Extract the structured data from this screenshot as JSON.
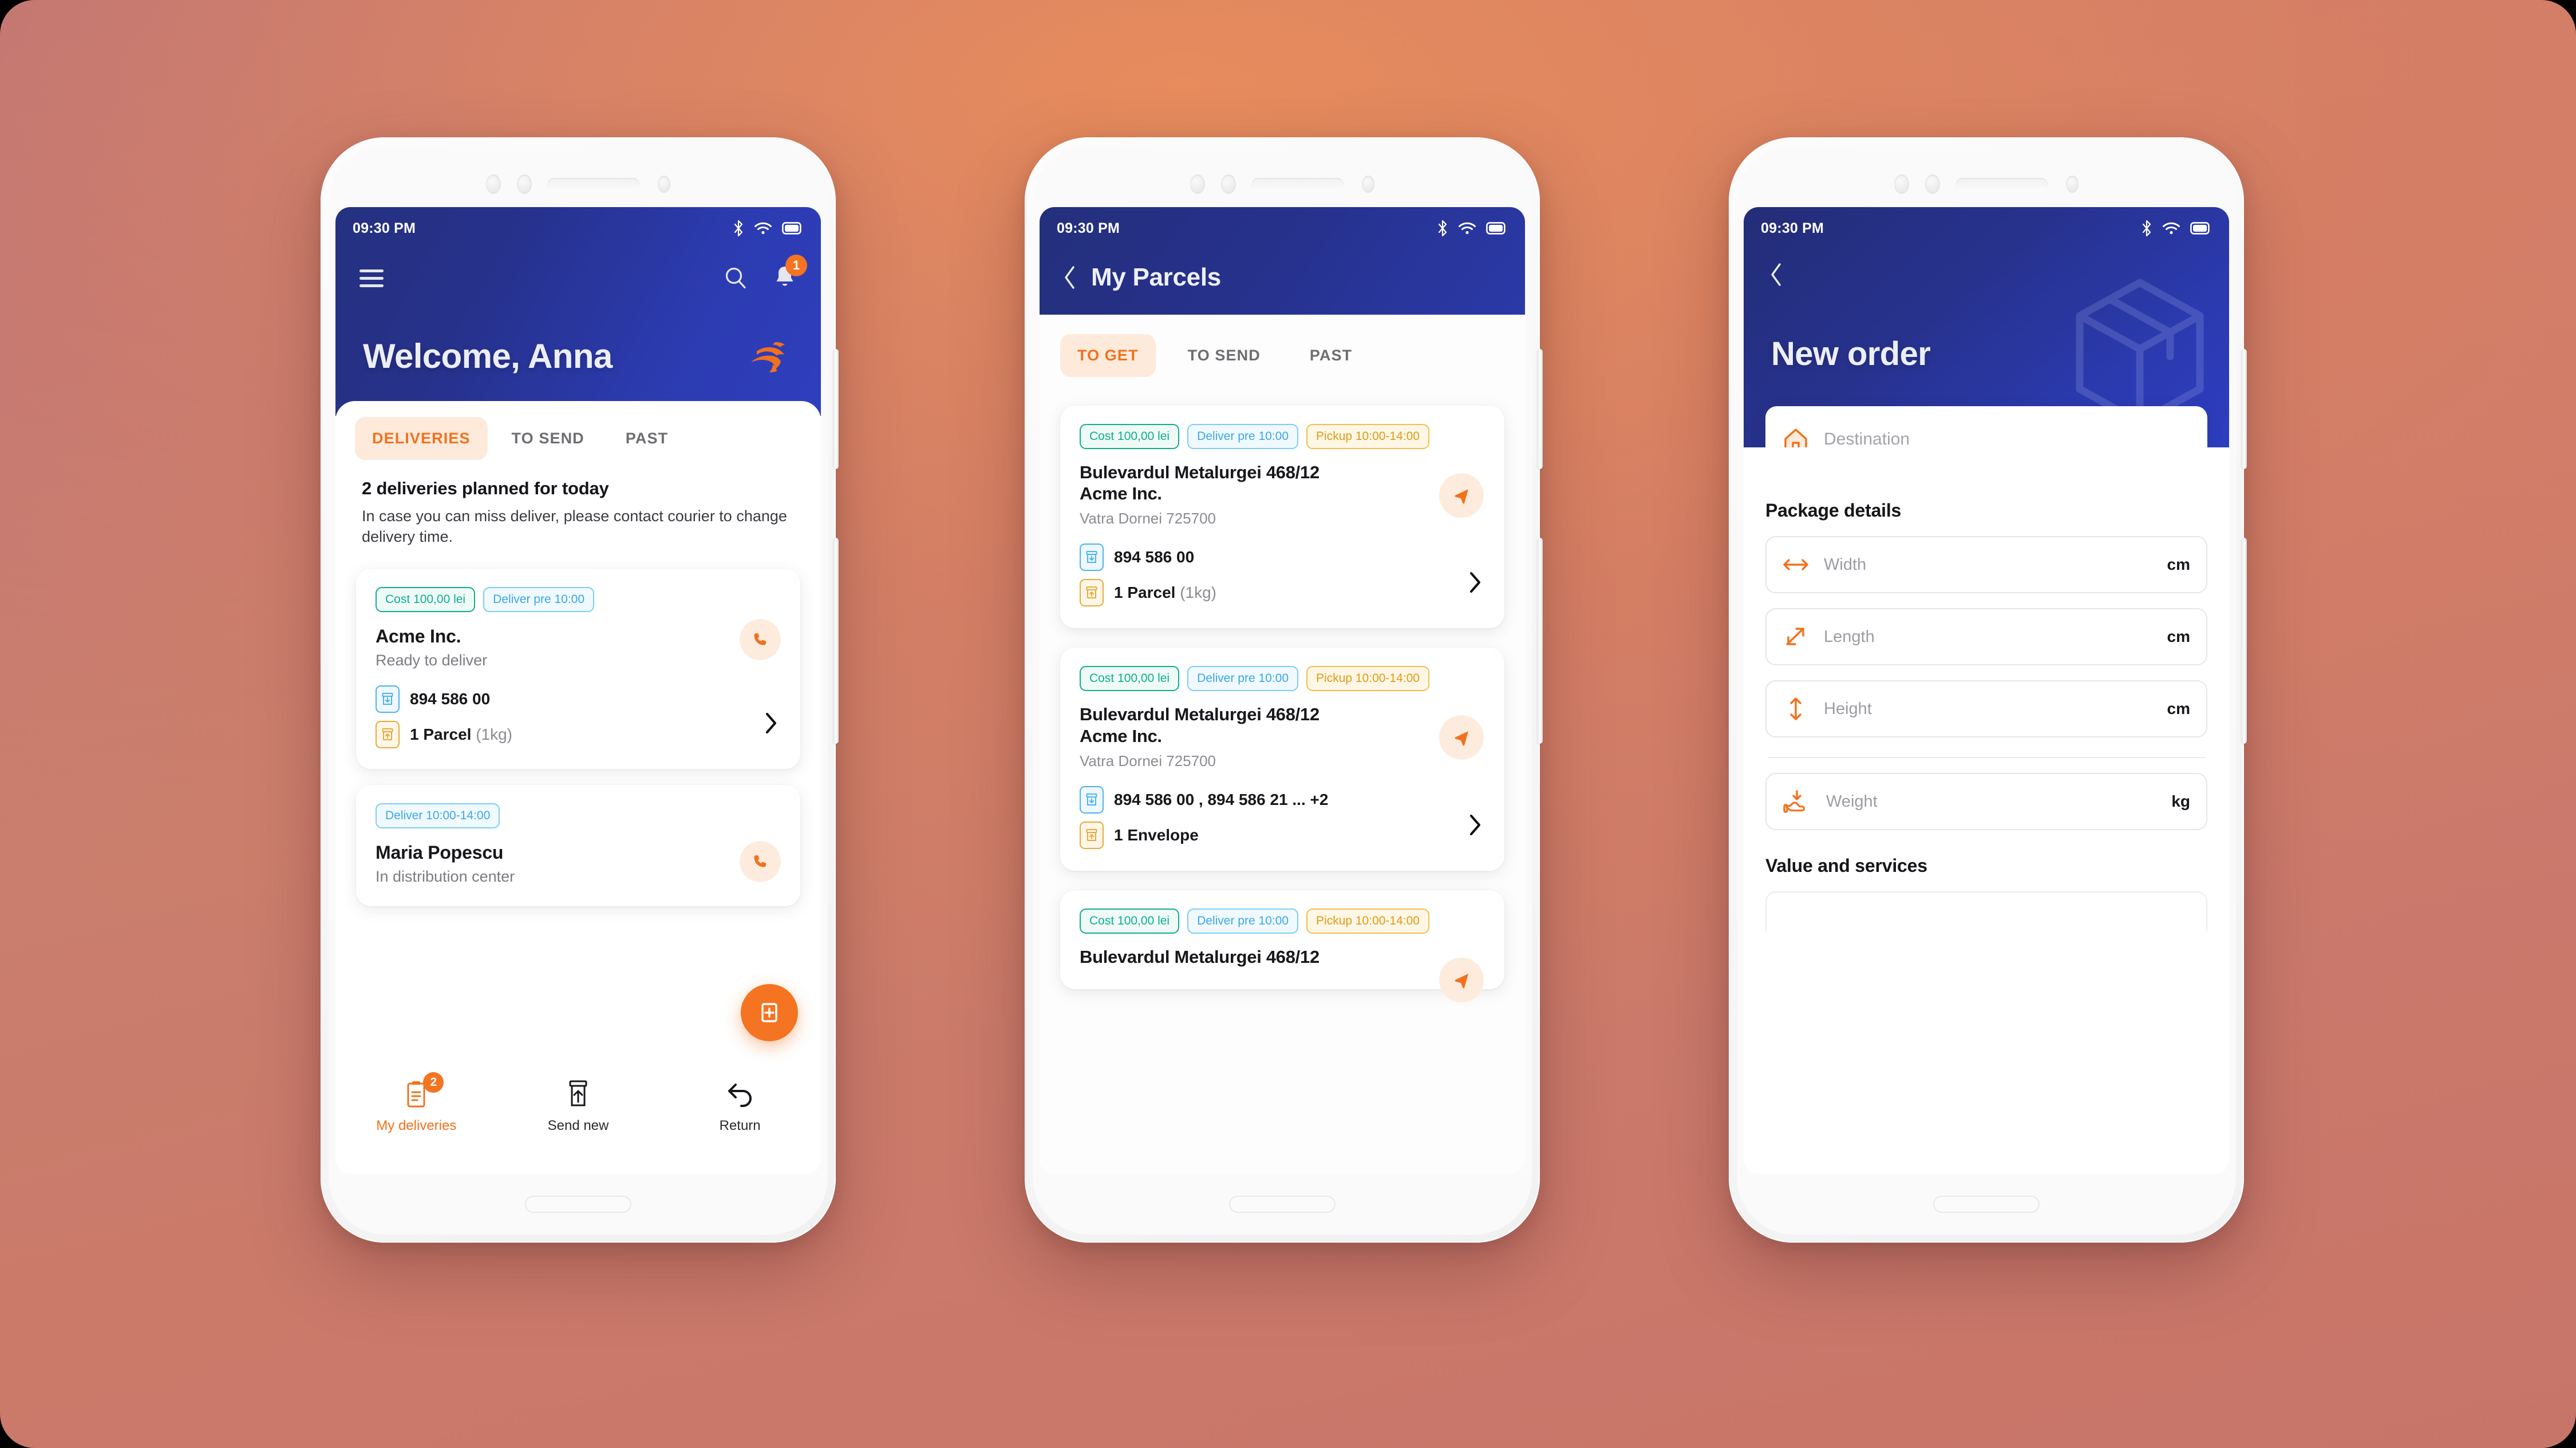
{
  "status_bar": {
    "time": "09:30 PM",
    "icons": [
      "bluetooth-icon",
      "wifi-icon",
      "battery-icon"
    ]
  },
  "phone1": {
    "header": {
      "menu_icon": "hamburger-menu-icon",
      "search_icon": "search-icon",
      "notification_icon": "bell-icon",
      "notification_count": "1",
      "welcome_title": "Welcome, Anna",
      "brand_logo": "running-courier-logo"
    },
    "tabs": [
      {
        "label": "DELIVERIES",
        "active": true
      },
      {
        "label": "TO SEND",
        "active": false
      },
      {
        "label": "PAST",
        "active": false
      }
    ],
    "summary": {
      "title": "2 deliveries planned for today",
      "subtitle": "In case you can miss deliver, please contact courier to change delivery time."
    },
    "cards": [
      {
        "chips": [
          {
            "text": "Cost 100,00 lei",
            "tone": "green"
          },
          {
            "text": "Deliver pre 10:00",
            "tone": "blue"
          }
        ],
        "title": "Acme Inc.",
        "subtitle": "Ready to deliver",
        "tracking": "894 586 00",
        "parcel": "1 Parcel",
        "parcel_weight": "(1kg)",
        "action_icon": "phone-icon"
      },
      {
        "chips": [
          {
            "text": "Deliver 10:00-14:00",
            "tone": "blue"
          }
        ],
        "title": "Maria Popescu",
        "subtitle": "In distribution center",
        "action_icon": "phone-icon"
      }
    ],
    "fab": {
      "icon": "add-parcel-icon"
    },
    "bottom_nav": [
      {
        "label": "My deliveries",
        "icon": "clipboard-icon",
        "badge": "2",
        "active": true
      },
      {
        "label": "Send new",
        "icon": "envelope-up-icon",
        "badge": "",
        "active": false
      },
      {
        "label": "Return",
        "icon": "return-arrow-icon",
        "badge": "",
        "active": false
      }
    ]
  },
  "phone2": {
    "header": {
      "back_icon": "chevron-left-icon",
      "title": "My Parcels"
    },
    "tabs": [
      {
        "label": "TO GET",
        "active": true
      },
      {
        "label": "TO SEND",
        "active": false
      },
      {
        "label": "PAST",
        "active": false
      }
    ],
    "cards": [
      {
        "chips": [
          {
            "text": "Cost 100,00 lei",
            "tone": "green"
          },
          {
            "text": "Deliver pre 10:00",
            "tone": "blue"
          },
          {
            "text": "Pickup 10:00-14:00",
            "tone": "yellow"
          }
        ],
        "address": "Bulevardul Metalurgei 468/12",
        "company": "Acme Inc.",
        "city": "Vatra Dornei 725700",
        "tracking": "894 586 00",
        "parcel": "1 Parcel",
        "parcel_weight": "(1kg)",
        "action_icon": "navigation-arrow-icon"
      },
      {
        "chips": [
          {
            "text": "Cost 100,00 lei",
            "tone": "green"
          },
          {
            "text": "Deliver pre 10:00",
            "tone": "blue"
          },
          {
            "text": "Pickup 10:00-14:00",
            "tone": "yellow"
          }
        ],
        "address": "Bulevardul Metalurgei 468/12",
        "company": "Acme Inc.",
        "city": "Vatra Dornei 725700",
        "tracking": "894 586 00 , 894 586 21 ... +2",
        "parcel": "1 Envelope",
        "parcel_weight": "",
        "action_icon": "navigation-arrow-icon"
      },
      {
        "chips": [
          {
            "text": "Cost 100,00 lei",
            "tone": "green"
          },
          {
            "text": "Deliver pre 10:00",
            "tone": "blue"
          },
          {
            "text": "Pickup 10:00-14:00",
            "tone": "yellow"
          }
        ],
        "address": "Bulevardul Metalurgei 468/12",
        "company": "",
        "city": "",
        "tracking": "",
        "parcel": "",
        "parcel_weight": "",
        "action_icon": "navigation-arrow-icon"
      }
    ]
  },
  "phone3": {
    "header": {
      "back_icon": "chevron-left-icon",
      "title": "New order",
      "watermark": "package-box-icon"
    },
    "destination": {
      "icon": "home-icon",
      "placeholder": "Destination"
    },
    "package_details": {
      "title": "Package details",
      "fields": [
        {
          "label": "Width",
          "unit": "cm",
          "icon": "arrows-horizontal-icon"
        },
        {
          "label": "Length",
          "unit": "cm",
          "icon": "arrow-diagonal-icon"
        },
        {
          "label": "Height",
          "unit": "cm",
          "icon": "arrows-vertical-icon"
        },
        {
          "label": "Weight",
          "unit": "kg",
          "icon": "hand-weight-icon"
        }
      ]
    },
    "value_services": {
      "title": "Value and services"
    }
  },
  "colors": {
    "accent_orange": "#f1711d",
    "header_blue": "#26318b",
    "chip_green": "#0fae8e",
    "chip_blue": "#3aa8e8",
    "chip_yellow": "#e09a14"
  }
}
